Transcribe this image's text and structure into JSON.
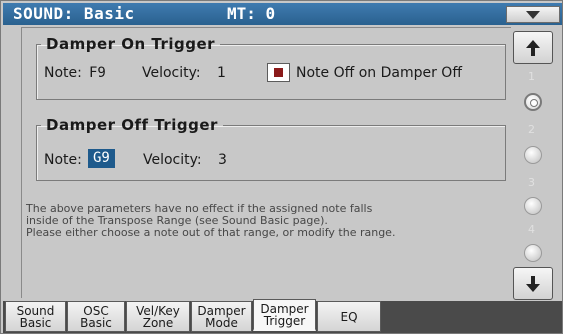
{
  "header": {
    "title": "SOUND: Basic",
    "mt": "MT: 0"
  },
  "damper_on": {
    "legend": "Damper On Trigger",
    "note_label": "Note:",
    "note_value": "F9",
    "velocity_label": "Velocity:",
    "velocity_value": "1",
    "checkbox_label": "Note Off on Damper Off",
    "checkbox_checked": true
  },
  "damper_off": {
    "legend": "Damper Off Trigger",
    "note_label": "Note:",
    "note_value": "G9",
    "velocity_label": "Velocity:",
    "velocity_value": "3"
  },
  "info_text": {
    "line1": "The above parameters have no effect if the assigned note falls",
    "line2": "inside of the Transpose Range (see Sound Basic page).",
    "line3": "Please either choose a note out of that range, or modify the range."
  },
  "scroll": {
    "indices": [
      "1",
      "2",
      "3",
      "4"
    ],
    "active_index": "1"
  },
  "tabs": [
    {
      "line1": "Sound",
      "line2": "Basic"
    },
    {
      "line1": "OSC",
      "line2": "Basic"
    },
    {
      "line1": "Vel/Key",
      "line2": "Zone"
    },
    {
      "line1": "Damper",
      "line2": "Mode"
    },
    {
      "line1": "Damper",
      "line2": "Trigger"
    },
    {
      "line1": "EQ",
      "line2": ""
    }
  ],
  "active_tab": "Damper Trigger",
  "colors": {
    "header": "#2f6a9c",
    "field_selected": "#1e5a8c",
    "checkbox_mark": "#8b1a1a"
  }
}
